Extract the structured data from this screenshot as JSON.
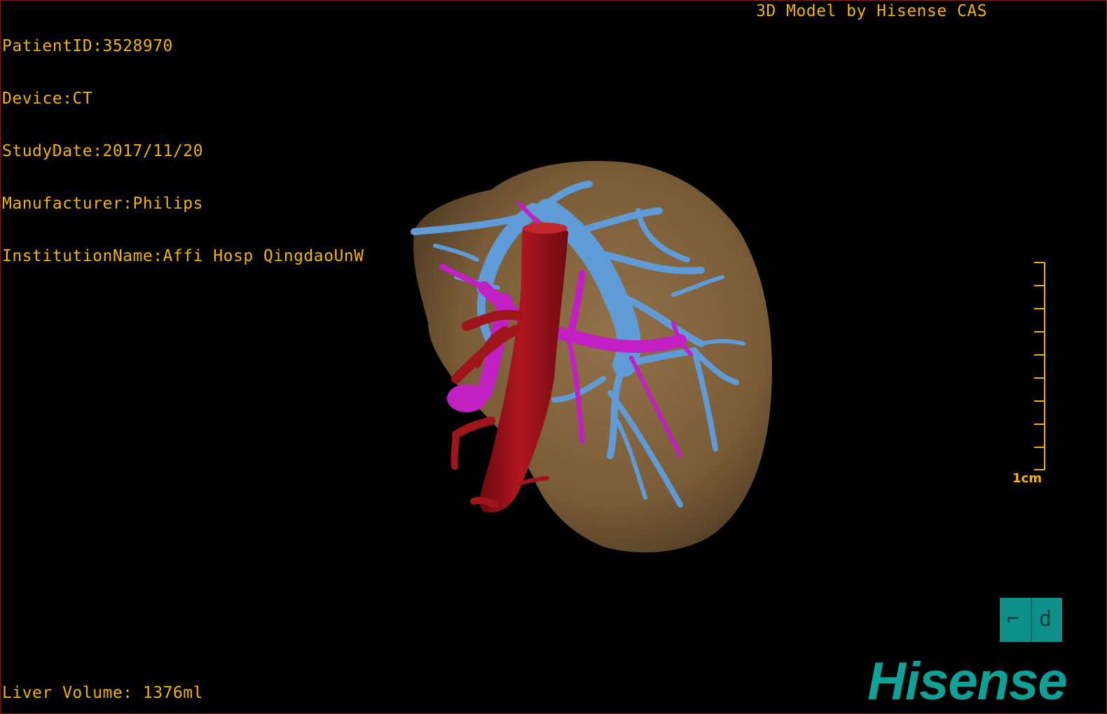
{
  "patient_info": {
    "patient_id": "PatientID:3528970",
    "device": "Device:CT",
    "study_date": "StudyDate:2017/11/20",
    "manufacturer": "Manufacturer:Philips",
    "institution": "InstitutionName:Affi Hosp QingdaoUnW"
  },
  "model_credit": "3D Model by Hisense CAS",
  "liver_volume": "Liver Volume: 1376ml",
  "scale_bar": {
    "label": "1cm",
    "ticks": 10
  },
  "view_cube": {
    "left_glyph": "⌐",
    "right_glyph": "d"
  },
  "brand": "Hisense",
  "colors": {
    "overlay_text": "#f0b400",
    "liver": "#8a6a43",
    "portal_vein": "#5f9bd6",
    "ivc": "#a0151c",
    "hepatic_artery": "#c21fc4",
    "brand": "#11a095"
  }
}
